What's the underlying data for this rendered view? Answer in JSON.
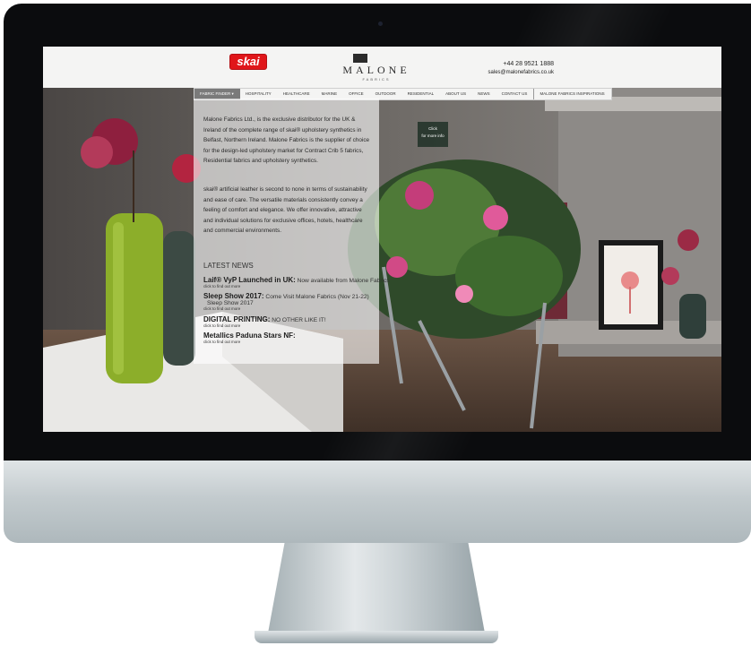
{
  "brand": {
    "skai_logo": "skai",
    "name": "MALONE",
    "subtitle": "FABRICS"
  },
  "contact": {
    "phone": "+44 28 9521 1888",
    "email": "sales@malonefabrics.co.uk"
  },
  "nav": [
    {
      "label": "FABRIC FINDER ▾",
      "active": true
    },
    {
      "label": "HOSPITALITY"
    },
    {
      "label": "HEALTHCARE"
    },
    {
      "label": "MARINE"
    },
    {
      "label": "OFFICE"
    },
    {
      "label": "OUTDOOR"
    },
    {
      "label": "RESIDENTIAL"
    },
    {
      "label": "ABOUT US"
    },
    {
      "label": "NEWS"
    },
    {
      "label": "CONTACT US"
    },
    {
      "label": "MALONE FABRICS INSPIRATIONS"
    }
  ],
  "intro": {
    "p1": "Malone Fabrics Ltd., is the exclusive distributor for the UK & Ireland of the complete range of skai® upholstery synthetics in Belfast, Northern Ireland. Malone Fabrics is the supplier of choice for the design-led upholstery market for Contract Crib 5 fabrics, Residential fabrics and upholstery synthetics.",
    "p2": "skai® artificial leather is second to none in terms of sustainability and ease of care. The versatile materials consistently convey a feeling of comfort and elegance. We offer innovative, attractive and individual solutions for exclusive offices, hotels, healthcare and commercial environments."
  },
  "news": {
    "title": "LATEST NEWS",
    "items": [
      {
        "head": "Laif® VyP Launched in UK:",
        "rest": " Now available from Malone Fabrics",
        "sub": "",
        "link": "click to find out more"
      },
      {
        "head": "Sleep Show 2017:",
        "rest": " Come Visit Malone Fabrics (Nov 21-22)",
        "sub": "Sleep Show 2017",
        "link": "click to find out more"
      },
      {
        "head": "DIGITAL PRINTING:",
        "rest": " NO OTHER LIKE IT!",
        "sub": "",
        "link": "click to find out more"
      },
      {
        "head": "Metallics Paduna Stars NF:",
        "rest": "",
        "sub": "",
        "link": "click to find out more"
      }
    ]
  },
  "badge": {
    "line1": "Click",
    "line2": "for more info"
  }
}
